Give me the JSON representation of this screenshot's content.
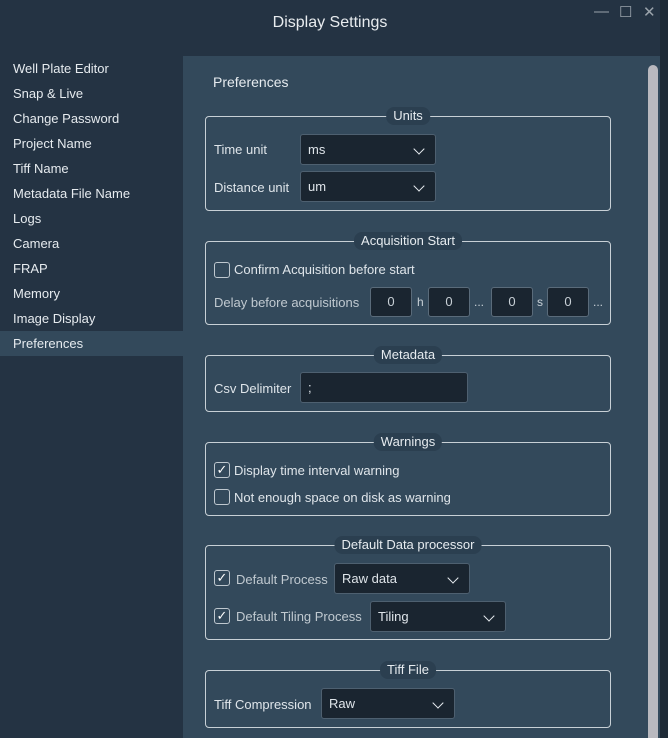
{
  "window": {
    "title": "Display Settings",
    "minimize": "—",
    "maximize": "☐",
    "close": "✕"
  },
  "sidebar": {
    "items": [
      {
        "label": "Well Plate Editor"
      },
      {
        "label": "Snap & Live"
      },
      {
        "label": "Change Password"
      },
      {
        "label": "Project Name"
      },
      {
        "label": "Tiff Name"
      },
      {
        "label": "Metadata File Name"
      },
      {
        "label": "Logs"
      },
      {
        "label": "Camera"
      },
      {
        "label": "FRAP"
      },
      {
        "label": "Memory"
      },
      {
        "label": "Image Display"
      },
      {
        "label": "Preferences"
      }
    ],
    "active": "Preferences"
  },
  "main": {
    "title": "Preferences",
    "units": {
      "title": "Units",
      "time_label": "Time unit",
      "time_value": "ms",
      "distance_label": "Distance unit",
      "distance_value": "um"
    },
    "acquisition": {
      "title": "Acquisition Start",
      "confirm_label": "Confirm Acquisition before start",
      "confirm_checked": false,
      "delay_label": "Delay before acquisitions",
      "h": "0",
      "h_unit": "h",
      "m": "0",
      "m_unit": "...",
      "s": "0",
      "s_unit": "s",
      "ms": "0",
      "ms_unit": "..."
    },
    "metadata": {
      "title": "Metadata",
      "csv_label": "Csv Delimiter",
      "csv_value": ";"
    },
    "warnings": {
      "title": "Warnings",
      "interval_label": "Display time interval warning",
      "interval_checked": true,
      "disk_label": "Not enough space on disk as warning",
      "disk_checked": false
    },
    "processor": {
      "title": "Default Data processor",
      "process_label": "Default Process",
      "process_value": "Raw data",
      "tiling_label": "Default Tiling Process",
      "tiling_value": "Tiling",
      "check": "✓"
    },
    "tiff": {
      "title": "Tiff File",
      "compression_label": "Tiff Compression",
      "compression_value": "Raw"
    }
  }
}
